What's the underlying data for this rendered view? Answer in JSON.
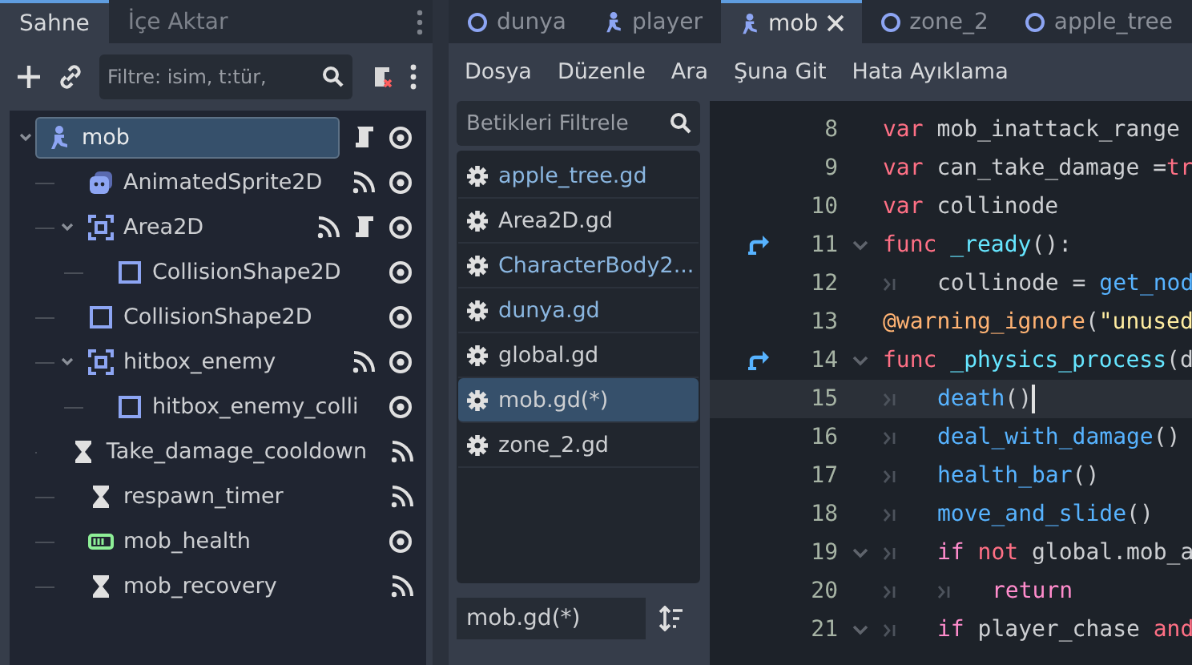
{
  "scene_panel": {
    "tabs": [
      {
        "label": "Sahne",
        "selected": true
      },
      {
        "label": "İçe Aktar",
        "selected": false
      }
    ],
    "filter": {
      "placeholder": "Filtre: isim, t:tür,"
    },
    "tree": [
      {
        "name": "mob",
        "kind": "character",
        "selected": true,
        "expanded": true,
        "signals": false,
        "script": true,
        "eye": true,
        "children": [
          {
            "name": "AnimatedSprite2D",
            "kind": "sprite",
            "selected": false,
            "signals": true,
            "script": false,
            "eye": true
          },
          {
            "name": "Area2D",
            "kind": "area",
            "selected": false,
            "expanded": true,
            "signals": true,
            "script": true,
            "eye": true,
            "children": [
              {
                "name": "CollisionShape2D",
                "kind": "shape",
                "selected": false,
                "signals": false,
                "script": false,
                "eye": true
              }
            ]
          },
          {
            "name": "CollisionShape2D",
            "kind": "shape",
            "selected": false,
            "signals": false,
            "script": false,
            "eye": true
          },
          {
            "name": "hitbox_enemy",
            "kind": "area",
            "selected": false,
            "expanded": true,
            "signals": true,
            "script": false,
            "eye": true,
            "children": [
              {
                "name": "hitbox_enemy_colli",
                "kind": "shape",
                "selected": false,
                "signals": false,
                "script": false,
                "eye": true
              }
            ]
          },
          {
            "name": "Take_damage_cooldown",
            "kind": "timer",
            "selected": false,
            "signals": true,
            "script": false,
            "eye": false
          },
          {
            "name": "respawn_timer",
            "kind": "timer",
            "selected": false,
            "signals": true,
            "script": false,
            "eye": false
          },
          {
            "name": "mob_health",
            "kind": "bar",
            "selected": false,
            "signals": false,
            "script": false,
            "eye": true
          },
          {
            "name": "mob_recovery",
            "kind": "timer",
            "selected": false,
            "signals": true,
            "script": false,
            "eye": false
          }
        ]
      }
    ]
  },
  "editor_tabs": [
    {
      "label": "dunya",
      "kind": "node",
      "selected": false
    },
    {
      "label": "player",
      "kind": "character",
      "selected": false
    },
    {
      "label": "mob",
      "kind": "character",
      "selected": true
    },
    {
      "label": "zone_2",
      "kind": "node",
      "selected": false
    },
    {
      "label": "apple_tree",
      "kind": "node",
      "selected": false
    }
  ],
  "menu": [
    "Dosya",
    "Düzenle",
    "Ara",
    "Şuna Git",
    "Hata Ayıklama"
  ],
  "scripts": {
    "filter": {
      "placeholder": "Betikleri Filtrele"
    },
    "files": [
      {
        "name": "apple_tree.gd",
        "color": "#8ab6e0",
        "selected": false
      },
      {
        "name": "Area2D.gd",
        "color": "#cdcfd2",
        "selected": false
      },
      {
        "name": "CharacterBody2...",
        "color": "#8ab6e0",
        "selected": false
      },
      {
        "name": "dunya.gd",
        "color": "#8ab6e0",
        "selected": false
      },
      {
        "name": "global.gd",
        "color": "#cdcfd2",
        "selected": false
      },
      {
        "name": "mob.gd(*)",
        "color": "#cdcfd2",
        "selected": true
      },
      {
        "name": "zone_2.gd",
        "color": "#cdcfd2",
        "selected": false
      }
    ],
    "current": {
      "value": "mob.gd(*)"
    }
  },
  "code": [
    {
      "number": "8",
      "override": false,
      "foldable": false,
      "current": false,
      "tokens": [
        {
          "kind": "keyword",
          "text": "var"
        },
        {
          "kind": "plain",
          "text": " mob_inattack_range"
        }
      ]
    },
    {
      "number": "9",
      "override": false,
      "foldable": false,
      "current": false,
      "tokens": [
        {
          "kind": "keyword",
          "text": "var"
        },
        {
          "kind": "plain",
          "text": " can_take_damage ="
        },
        {
          "kind": "keyword",
          "text": "tr"
        }
      ]
    },
    {
      "number": "10",
      "override": false,
      "foldable": false,
      "current": false,
      "tokens": [
        {
          "kind": "keyword",
          "text": "var"
        },
        {
          "kind": "plain",
          "text": " collinode"
        }
      ]
    },
    {
      "number": "11",
      "override": true,
      "foldable": true,
      "current": false,
      "tokens": [
        {
          "kind": "keyword",
          "text": "func"
        },
        {
          "kind": "funcname",
          "text": " _ready"
        },
        {
          "kind": "plain",
          "text": "():"
        }
      ]
    },
    {
      "number": "12",
      "override": false,
      "foldable": false,
      "current": false,
      "tokens": [
        {
          "kind": "tab"
        },
        {
          "kind": "plain",
          "text": "collinode = "
        },
        {
          "kind": "call",
          "text": "get_nod"
        }
      ]
    },
    {
      "number": "13",
      "override": false,
      "foldable": false,
      "current": false,
      "tokens": [
        {
          "kind": "annotation",
          "text": "@warning_ignore"
        },
        {
          "kind": "plain",
          "text": "("
        },
        {
          "kind": "string",
          "text": "\"unused"
        }
      ]
    },
    {
      "number": "14",
      "override": true,
      "foldable": true,
      "current": false,
      "tokens": [
        {
          "kind": "keyword",
          "text": "func"
        },
        {
          "kind": "funcname",
          "text": " _physics_process"
        },
        {
          "kind": "plain",
          "text": "(d"
        }
      ]
    },
    {
      "number": "15",
      "override": false,
      "foldable": false,
      "current": true,
      "tokens": [
        {
          "kind": "tab"
        },
        {
          "kind": "call",
          "text": "death"
        },
        {
          "kind": "plain",
          "text": "()"
        }
      ]
    },
    {
      "number": "16",
      "override": false,
      "foldable": false,
      "current": false,
      "tokens": [
        {
          "kind": "tab"
        },
        {
          "kind": "call",
          "text": "deal_with_damage"
        },
        {
          "kind": "plain",
          "text": "()"
        }
      ]
    },
    {
      "number": "17",
      "override": false,
      "foldable": false,
      "current": false,
      "tokens": [
        {
          "kind": "tab"
        },
        {
          "kind": "call",
          "text": "health_bar"
        },
        {
          "kind": "plain",
          "text": "()"
        }
      ]
    },
    {
      "number": "18",
      "override": false,
      "foldable": false,
      "current": false,
      "tokens": [
        {
          "kind": "tab"
        },
        {
          "kind": "call",
          "text": "move_and_slide"
        },
        {
          "kind": "plain",
          "text": "()"
        }
      ]
    },
    {
      "number": "19",
      "override": false,
      "foldable": true,
      "current": false,
      "tokens": [
        {
          "kind": "tab"
        },
        {
          "kind": "control",
          "text": "if"
        },
        {
          "kind": "keyword",
          "text": " not"
        },
        {
          "kind": "plain",
          "text": " global.mob_a"
        }
      ]
    },
    {
      "number": "20",
      "override": false,
      "foldable": false,
      "current": false,
      "tokens": [
        {
          "kind": "tab"
        },
        {
          "kind": "tab"
        },
        {
          "kind": "control",
          "text": "return"
        }
      ]
    },
    {
      "number": "21",
      "override": false,
      "foldable": true,
      "current": false,
      "tokens": [
        {
          "kind": "tab"
        },
        {
          "kind": "control",
          "text": "if"
        },
        {
          "kind": "plain",
          "text": " player_chase "
        },
        {
          "kind": "keyword",
          "text": "and"
        }
      ]
    }
  ]
}
